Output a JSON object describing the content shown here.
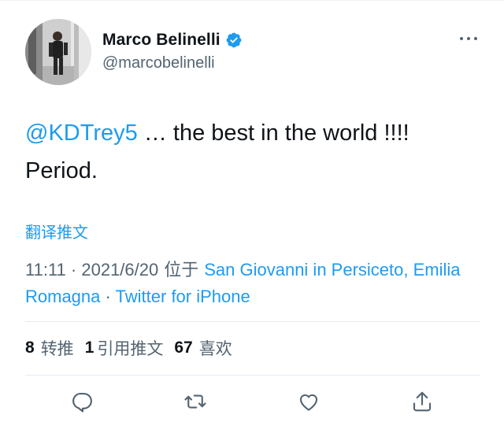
{
  "tweet": {
    "display_name": "Marco Belinelli",
    "handle": "@marcobelinelli",
    "text": {
      "mention": "@KDTrey5",
      "rest": " … the best in the world !!!!",
      "line2": "Period."
    },
    "translate_label": "翻译推文",
    "meta": {
      "time": "11:11",
      "sep1": " · ",
      "date": "2021/6/20",
      "location_prefix": " 位于 ",
      "location": "San Giovanni in Persiceto, Emilia Romagna",
      "sep2": " · ",
      "source": "Twitter for iPhone"
    },
    "stats": {
      "retweets_count": "8",
      "retweets_label": "转推",
      "quotes_count": "1",
      "quotes_label": "引用推文",
      "likes_count": "67",
      "likes_label": "喜欢"
    }
  },
  "icons": {
    "verified": "verified-badge-icon",
    "more": "more-horizontal-icon",
    "reply": "reply-icon",
    "retweet": "retweet-icon",
    "like": "heart-icon",
    "share": "share-icon"
  },
  "colors": {
    "accent": "#1d9bf0",
    "text_primary": "#0f1419",
    "text_secondary": "#536471",
    "divider": "#e6ecf0"
  }
}
